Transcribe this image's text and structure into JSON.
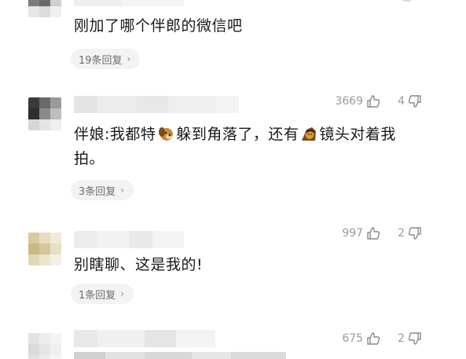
{
  "comments": [
    {
      "text": "刚加了哪个伴郎的微信吧",
      "reply_label": "19条回复",
      "chevron": "›"
    },
    {
      "likes": "3669",
      "dislikes": "4",
      "text_part1": "伴娘:我都特",
      "text_part2": "躲到角落了，还有",
      "text_part3": "镜头对着我",
      "text_part4": "拍。",
      "reply_label": "3条回复",
      "chevron": "›"
    },
    {
      "likes": "997",
      "dislikes": "2",
      "text": "别瞎聊、这是我的!",
      "reply_label": "1条回复",
      "chevron": "›"
    },
    {
      "likes": "675",
      "dislikes": "2"
    }
  ],
  "icons": {
    "like": "thumbs-up-icon",
    "dislike": "thumbs-down-icon",
    "emoji_dog": "dog-emoji-icon",
    "emoji_man": "man-emoji-icon"
  },
  "colors": {
    "muted_text": "#9a9a9a",
    "pill_bg": "#f3f3f3"
  }
}
